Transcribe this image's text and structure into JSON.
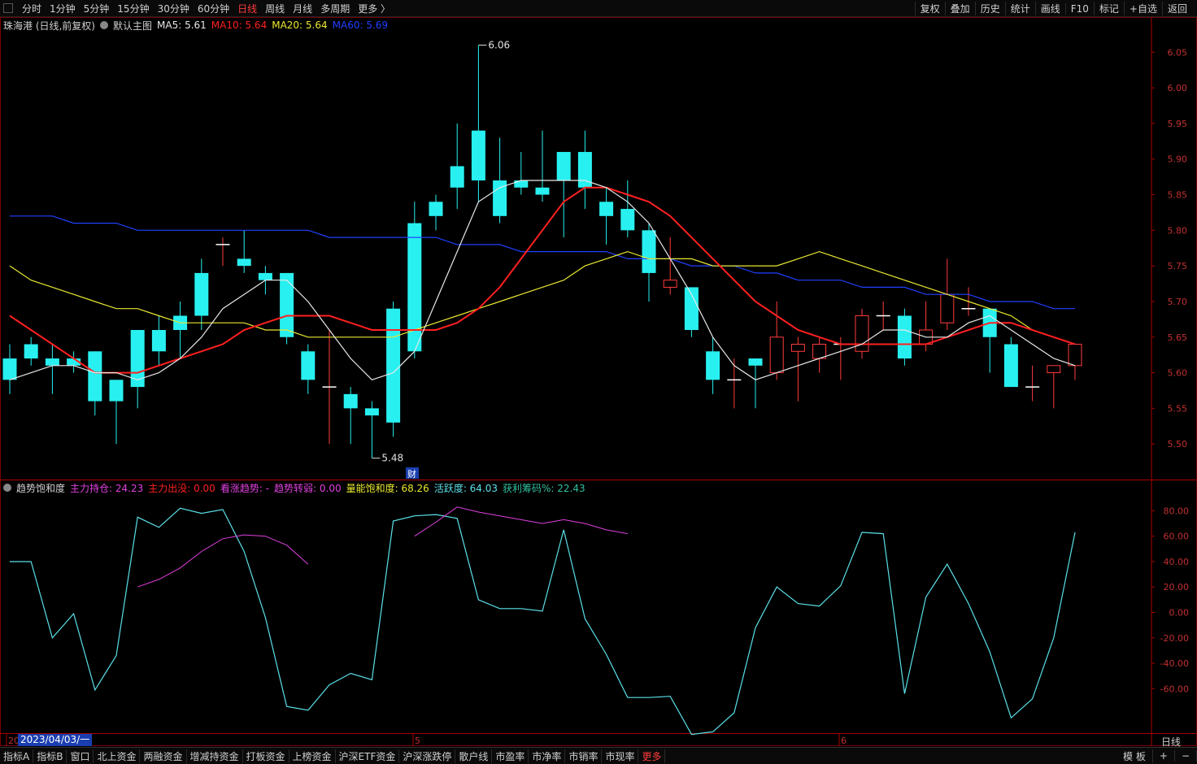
{
  "toolbar": {
    "periods": [
      "分时",
      "1分钟",
      "5分钟",
      "15分钟",
      "30分钟",
      "60分钟",
      "日线",
      "周线",
      "月线",
      "多周期",
      "更多 〉"
    ],
    "active_period": "日线",
    "tools": [
      "复权",
      "叠加",
      "历史",
      "统计",
      "画线",
      "F10",
      "标记",
      "+自选",
      "返回"
    ]
  },
  "main_info": {
    "stock": "珠海港 (日线,前复权)",
    "template": "默认主图",
    "ma5": "MA5: 5.61",
    "ma10": "MA10: 5.64",
    "ma20": "MA20: 5.64",
    "ma60": "MA60: 5.69"
  },
  "sub_info": {
    "name": "趋势饱和度",
    "zlcc": "主力持仓: 24.23",
    "zlcm": "主力出没: 0.00",
    "kzqs": "看涨趋势: -",
    "qszr": "趋势转弱: 0.00",
    "lnbh": "量能饱和度: 68.26",
    "hyd": "活跃度: 64.03",
    "hlcm": "获利筹码%: 22.43"
  },
  "colors": {
    "up": "#ff3b3b",
    "down": "#28f0f0",
    "ma5": "#e8e8e8",
    "ma10": "#ff2020",
    "ma20": "#e8e830",
    "ma60": "#2040ff",
    "sub_line1": "#5ae0e8",
    "sub_line2": "#e040e0"
  },
  "chart_data": {
    "type": "candlestick",
    "ylim": [
      5.45,
      6.08
    ],
    "yticks": [
      "6.05",
      "6.00",
      "5.95",
      "5.90",
      "5.85",
      "5.80",
      "5.75",
      "5.70",
      "5.65",
      "5.60",
      "5.55",
      "5.50"
    ],
    "high_label": "6.06",
    "low_label": "5.48",
    "event_marker": "财",
    "x_month_labels": [
      "20",
      "5",
      "6"
    ],
    "candles": [
      [
        5.62,
        5.59,
        5.64,
        5.57
      ],
      [
        5.64,
        5.62,
        5.65,
        5.61
      ],
      [
        5.62,
        5.61,
        5.64,
        5.57
      ],
      [
        5.62,
        5.61,
        5.63,
        5.6
      ],
      [
        5.63,
        5.56,
        5.63,
        5.54
      ],
      [
        5.59,
        5.56,
        5.59,
        5.5
      ],
      [
        5.66,
        5.58,
        5.66,
        5.55
      ],
      [
        5.66,
        5.63,
        5.68,
        5.61
      ],
      [
        5.68,
        5.66,
        5.7,
        5.62
      ],
      [
        5.74,
        5.68,
        5.76,
        5.66
      ],
      [
        5.78,
        5.78,
        5.79,
        5.75
      ],
      [
        5.76,
        5.75,
        5.8,
        5.74
      ],
      [
        5.74,
        5.73,
        5.75,
        5.71
      ],
      [
        5.74,
        5.65,
        5.74,
        5.64
      ],
      [
        5.63,
        5.59,
        5.64,
        5.57
      ],
      [
        5.58,
        5.58,
        5.66,
        5.5
      ],
      [
        5.57,
        5.55,
        5.58,
        5.5
      ],
      [
        5.55,
        5.54,
        5.56,
        5.48
      ],
      [
        5.69,
        5.53,
        5.7,
        5.51
      ],
      [
        5.81,
        5.63,
        5.84,
        5.62
      ],
      [
        5.84,
        5.82,
        5.85,
        5.8
      ],
      [
        5.89,
        5.86,
        5.95,
        5.83
      ],
      [
        5.94,
        5.87,
        6.06,
        5.84
      ],
      [
        5.87,
        5.82,
        5.93,
        5.81
      ],
      [
        5.87,
        5.86,
        5.91,
        5.85
      ],
      [
        5.86,
        5.85,
        5.94,
        5.84
      ],
      [
        5.91,
        5.87,
        5.91,
        5.79
      ],
      [
        5.91,
        5.86,
        5.94,
        5.83
      ],
      [
        5.84,
        5.82,
        5.86,
        5.78
      ],
      [
        5.83,
        5.8,
        5.87,
        5.79
      ],
      [
        5.8,
        5.74,
        5.81,
        5.7
      ],
      [
        5.72,
        5.73,
        5.79,
        5.71
      ],
      [
        5.72,
        5.66,
        5.72,
        5.65
      ],
      [
        5.63,
        5.59,
        5.65,
        5.57
      ],
      [
        5.59,
        5.59,
        5.62,
        5.55
      ],
      [
        5.62,
        5.61,
        5.62,
        5.55
      ],
      [
        5.6,
        5.65,
        5.7,
        5.59
      ],
      [
        5.63,
        5.64,
        5.65,
        5.56
      ],
      [
        5.62,
        5.64,
        5.65,
        5.6
      ],
      [
        5.64,
        5.64,
        5.65,
        5.59
      ],
      [
        5.63,
        5.68,
        5.69,
        5.62
      ],
      [
        5.68,
        5.68,
        5.7,
        5.66
      ],
      [
        5.68,
        5.62,
        5.69,
        5.61
      ],
      [
        5.64,
        5.66,
        5.7,
        5.63
      ],
      [
        5.67,
        5.71,
        5.76,
        5.66
      ],
      [
        5.69,
        5.69,
        5.72,
        5.68
      ],
      [
        5.69,
        5.65,
        5.69,
        5.6
      ],
      [
        5.64,
        5.58,
        5.65,
        5.58
      ],
      [
        5.58,
        5.58,
        5.61,
        5.56
      ],
      [
        5.6,
        5.61,
        5.61,
        5.55
      ],
      [
        5.61,
        5.64,
        5.64,
        5.59
      ]
    ],
    "ma5": [
      5.59,
      5.6,
      5.61,
      5.61,
      5.6,
      5.6,
      5.59,
      5.6,
      5.62,
      5.65,
      5.69,
      5.71,
      5.73,
      5.73,
      5.7,
      5.66,
      5.62,
      5.59,
      5.6,
      5.63,
      5.7,
      5.77,
      5.84,
      5.86,
      5.87,
      5.87,
      5.87,
      5.87,
      5.86,
      5.84,
      5.81,
      5.76,
      5.71,
      5.65,
      5.61,
      5.59,
      5.6,
      5.61,
      5.62,
      5.63,
      5.64,
      5.66,
      5.66,
      5.65,
      5.65,
      5.67,
      5.68,
      5.66,
      5.64,
      5.62,
      5.61
    ],
    "ma10": [
      5.68,
      5.66,
      5.64,
      5.62,
      5.6,
      5.6,
      5.6,
      5.61,
      5.62,
      5.63,
      5.64,
      5.66,
      5.67,
      5.68,
      5.68,
      5.68,
      5.67,
      5.66,
      5.66,
      5.66,
      5.66,
      5.67,
      5.69,
      5.72,
      5.76,
      5.8,
      5.84,
      5.86,
      5.86,
      5.85,
      5.84,
      5.82,
      5.79,
      5.76,
      5.73,
      5.7,
      5.68,
      5.66,
      5.65,
      5.64,
      5.64,
      5.64,
      5.64,
      5.64,
      5.65,
      5.66,
      5.67,
      5.67,
      5.66,
      5.65,
      5.64
    ],
    "ma20": [
      5.75,
      5.73,
      5.72,
      5.71,
      5.7,
      5.69,
      5.69,
      5.68,
      5.67,
      5.67,
      5.67,
      5.67,
      5.66,
      5.66,
      5.65,
      5.65,
      5.65,
      5.65,
      5.65,
      5.66,
      5.67,
      5.68,
      5.69,
      5.7,
      5.71,
      5.72,
      5.73,
      5.75,
      5.76,
      5.77,
      5.76,
      5.76,
      5.76,
      5.75,
      5.75,
      5.75,
      5.75,
      5.76,
      5.77,
      5.76,
      5.75,
      5.74,
      5.73,
      5.72,
      5.71,
      5.7,
      5.69,
      5.68,
      5.66,
      5.65,
      5.64
    ],
    "ma60": [
      5.82,
      5.82,
      5.82,
      5.81,
      5.81,
      5.81,
      5.8,
      5.8,
      5.8,
      5.8,
      5.8,
      5.8,
      5.8,
      5.8,
      5.8,
      5.79,
      5.79,
      5.79,
      5.79,
      5.79,
      5.79,
      5.78,
      5.78,
      5.78,
      5.77,
      5.77,
      5.77,
      5.77,
      5.77,
      5.76,
      5.76,
      5.76,
      5.75,
      5.75,
      5.75,
      5.74,
      5.74,
      5.73,
      5.73,
      5.73,
      5.72,
      5.72,
      5.72,
      5.71,
      5.71,
      5.71,
      5.7,
      5.7,
      5.7,
      5.69,
      5.69
    ],
    "sub_ylim": [
      -95,
      95
    ],
    "sub_yticks": [
      "80.00",
      "60.00",
      "40.00",
      "20.00",
      "0.00",
      "-20.00",
      "-40.00",
      "-60.00"
    ],
    "sub_line1": [
      40,
      40,
      -20,
      -1,
      -61,
      -34,
      75,
      67,
      82,
      78,
      81,
      48,
      -4,
      -74,
      -77,
      -57,
      -48,
      -53,
      72,
      76,
      77,
      74,
      10,
      3,
      3,
      1,
      65,
      -5,
      -33,
      -67,
      -67,
      -66,
      -96,
      -94,
      -79,
      -12,
      20,
      7,
      5,
      21,
      63,
      62,
      -64,
      12,
      38,
      7,
      -31,
      -83,
      -68,
      -20,
      63
    ],
    "sub_line2_a": [
      null,
      null,
      null,
      null,
      null,
      null,
      20,
      26,
      35,
      48,
      58,
      61,
      60,
      53,
      38
    ],
    "sub_line2_b_start": 19,
    "sub_line2_b": [
      60,
      71,
      83,
      79,
      76,
      73,
      70,
      73,
      70,
      65,
      62
    ]
  }
}
